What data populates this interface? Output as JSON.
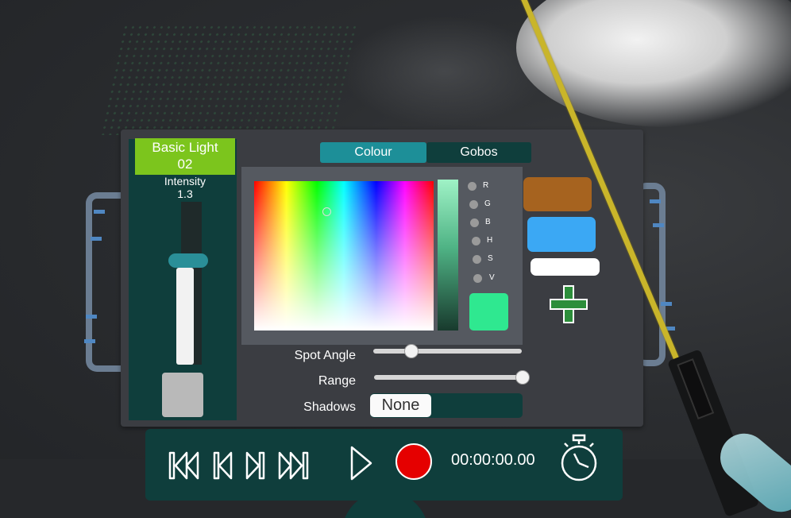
{
  "light": {
    "title_line1": "Basic Light",
    "title_line2": "02",
    "intensity_label": "Intensity",
    "intensity_value": "1.3",
    "intensity_level": 0.6
  },
  "tabs": {
    "colour": "Colour",
    "gobos": "Gobos"
  },
  "channels": [
    "R",
    "G",
    "B",
    "H",
    "S",
    "V"
  ],
  "selected_colour": "#2fe890",
  "palette": [
    "#a6631f",
    "#3ba8f4",
    "#ffffff"
  ],
  "properties": {
    "spot_angle": {
      "label": "Spot Angle",
      "level": 0.25
    },
    "range": {
      "label": "Range",
      "level": 1.0
    },
    "shadows": {
      "label": "Shadows",
      "value": "None"
    }
  },
  "transport": {
    "time": "00:00:00.00"
  },
  "colors": {
    "panel": "#3b3d42",
    "teal_dark": "#0f3e3c",
    "accent_teal": "#1d8f98",
    "green_title": "#7cc51d",
    "record": "#e50000"
  }
}
